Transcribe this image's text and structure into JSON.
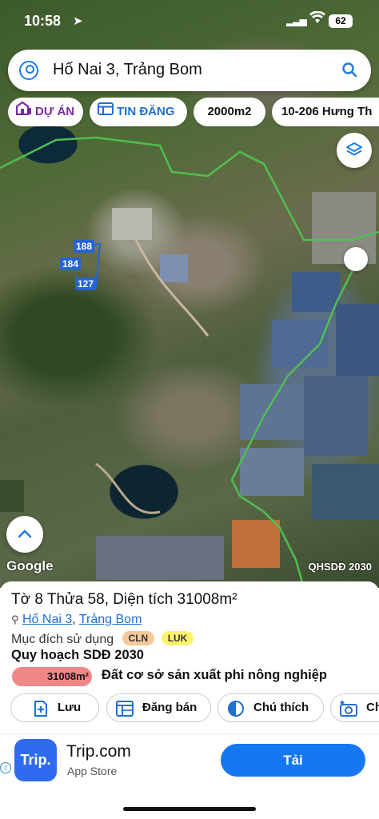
{
  "status": {
    "time": "10:58",
    "battery": "62"
  },
  "search": {
    "query": "Hố Nai 3, Trảng Bom"
  },
  "chips": [
    {
      "label": "DỰ ÁN",
      "color": "#7a2aa0"
    },
    {
      "label": "TIN ĐĂNG",
      "color": "#1e6fd0"
    },
    {
      "label": "2000m2"
    },
    {
      "label": "10-206 Hưng Th"
    }
  ],
  "map": {
    "plots": [
      "188",
      "184",
      "127"
    ],
    "attribution": "Google",
    "overlay_label": "QHSDĐ 2030",
    "boundary_color": "#4fbf4f",
    "plot_color": "#2563d6"
  },
  "parcel": {
    "title": "Tờ 8 Thửa 58, Diện tích 31008m²",
    "ward": "Hố Nai 3",
    "district": "Trảng Bom",
    "purpose_label": "Mục đích sử dụng",
    "tags": [
      {
        "code": "CLN",
        "color": "#f6c99a"
      },
      {
        "code": "LUK",
        "color": "#fff36a"
      }
    ],
    "plan_label": "Quy hoạch SDĐ 2030",
    "area_badge": "31008m²",
    "area_color": "#f08787",
    "land_use": "Đất cơ sở sản xuất phi nông nghiệp"
  },
  "actions": [
    {
      "label": "Lưu",
      "icon": "plus-doc-icon"
    },
    {
      "label": "Đăng bán",
      "icon": "grid-icon"
    },
    {
      "label": "Chú thích",
      "icon": "half-circle-icon"
    },
    {
      "label": "Ch",
      "icon": "camera-plus-icon"
    }
  ],
  "ad": {
    "logo": "Trip.",
    "name": "Trip.com",
    "store": "App Store",
    "cta": "Tải",
    "info": "i"
  }
}
